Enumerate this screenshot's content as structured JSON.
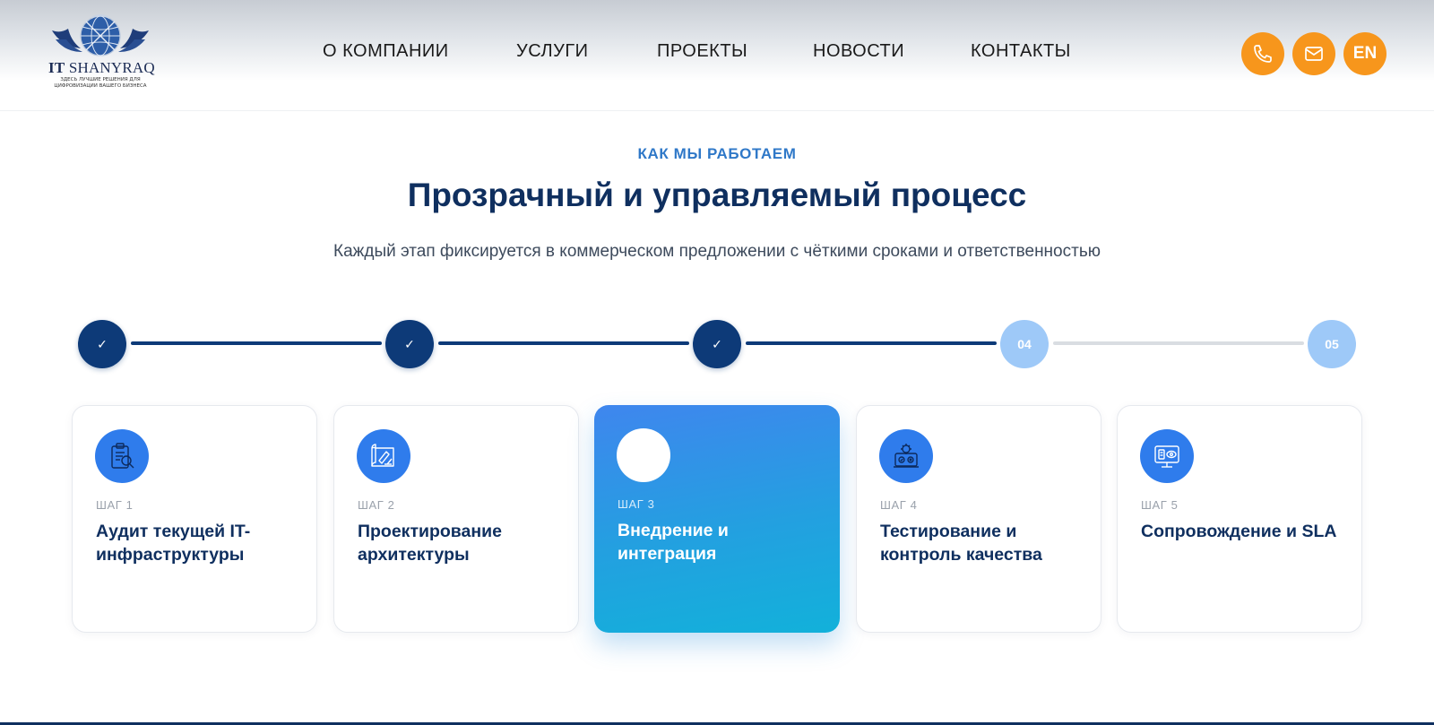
{
  "brand": {
    "name_prefix": "IT",
    "name_main": "SHANYRAQ",
    "tagline_1": "ЗДЕСЬ ЛУЧШИЕ РЕШЕНИЯ ДЛЯ",
    "tagline_2": "ЦИФРОВИЗАЦИИ ВАШЕГО БИЗНЕСА"
  },
  "nav": {
    "items": [
      {
        "label": "О КОМПАНИИ"
      },
      {
        "label": "УСЛУГИ"
      },
      {
        "label": "ПРОЕКТЫ"
      },
      {
        "label": "НОВОСТИ"
      },
      {
        "label": "КОНТАКТЫ"
      }
    ]
  },
  "header_actions": {
    "phone_icon": "phone-icon",
    "mail_icon": "mail-icon",
    "language_label": "EN",
    "accent_color": "#f7961c"
  },
  "section": {
    "eyebrow": "КАК МЫ РАБОТАЕМ",
    "title": "Прозрачный и управляемый процесс",
    "subtitle": "Каждый этап фиксируется в коммерческом предложении с чёткими сроками и ответственностью"
  },
  "stepper": {
    "completed_color": "#0d3a78",
    "pending_color": "#9ec9f8",
    "steps": [
      {
        "state": "done",
        "label": "✓"
      },
      {
        "state": "done",
        "label": "✓"
      },
      {
        "state": "done",
        "label": "✓"
      },
      {
        "state": "pending",
        "label": "04"
      },
      {
        "state": "pending",
        "label": "05"
      }
    ]
  },
  "cards": [
    {
      "step": "ШАГ 1",
      "title": "Аудит текущей IT-инфраструктуры",
      "icon": "audit-clipboard-icon",
      "active": false
    },
    {
      "step": "ШАГ 2",
      "title": "Проектирование архитектуры",
      "icon": "blueprint-design-icon",
      "active": false
    },
    {
      "step": "ШАГ 3",
      "title": "Внедрение и интеграция",
      "icon": "integration-icon",
      "active": true
    },
    {
      "step": "ШАГ 4",
      "title": "Тестирование и контроль качества",
      "icon": "testing-gear-icon",
      "active": false
    },
    {
      "step": "ШАГ 5",
      "title": "Сопровождение и SLA",
      "icon": "monitor-support-icon",
      "active": false
    }
  ]
}
